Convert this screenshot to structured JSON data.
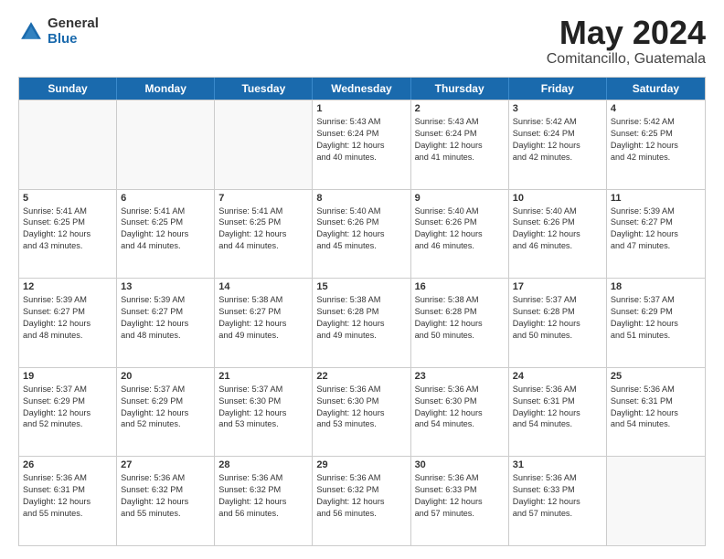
{
  "logo": {
    "general": "General",
    "blue": "Blue"
  },
  "title": {
    "month": "May 2024",
    "location": "Comitancillo, Guatemala"
  },
  "header_days": [
    "Sunday",
    "Monday",
    "Tuesday",
    "Wednesday",
    "Thursday",
    "Friday",
    "Saturday"
  ],
  "weeks": [
    [
      {
        "day": "",
        "text": "",
        "empty": true
      },
      {
        "day": "",
        "text": "",
        "empty": true
      },
      {
        "day": "",
        "text": "",
        "empty": true
      },
      {
        "day": "1",
        "text": "Sunrise: 5:43 AM\nSunset: 6:24 PM\nDaylight: 12 hours\nand 40 minutes.",
        "empty": false
      },
      {
        "day": "2",
        "text": "Sunrise: 5:43 AM\nSunset: 6:24 PM\nDaylight: 12 hours\nand 41 minutes.",
        "empty": false
      },
      {
        "day": "3",
        "text": "Sunrise: 5:42 AM\nSunset: 6:24 PM\nDaylight: 12 hours\nand 42 minutes.",
        "empty": false
      },
      {
        "day": "4",
        "text": "Sunrise: 5:42 AM\nSunset: 6:25 PM\nDaylight: 12 hours\nand 42 minutes.",
        "empty": false
      }
    ],
    [
      {
        "day": "5",
        "text": "Sunrise: 5:41 AM\nSunset: 6:25 PM\nDaylight: 12 hours\nand 43 minutes.",
        "empty": false
      },
      {
        "day": "6",
        "text": "Sunrise: 5:41 AM\nSunset: 6:25 PM\nDaylight: 12 hours\nand 44 minutes.",
        "empty": false
      },
      {
        "day": "7",
        "text": "Sunrise: 5:41 AM\nSunset: 6:25 PM\nDaylight: 12 hours\nand 44 minutes.",
        "empty": false
      },
      {
        "day": "8",
        "text": "Sunrise: 5:40 AM\nSunset: 6:26 PM\nDaylight: 12 hours\nand 45 minutes.",
        "empty": false
      },
      {
        "day": "9",
        "text": "Sunrise: 5:40 AM\nSunset: 6:26 PM\nDaylight: 12 hours\nand 46 minutes.",
        "empty": false
      },
      {
        "day": "10",
        "text": "Sunrise: 5:40 AM\nSunset: 6:26 PM\nDaylight: 12 hours\nand 46 minutes.",
        "empty": false
      },
      {
        "day": "11",
        "text": "Sunrise: 5:39 AM\nSunset: 6:27 PM\nDaylight: 12 hours\nand 47 minutes.",
        "empty": false
      }
    ],
    [
      {
        "day": "12",
        "text": "Sunrise: 5:39 AM\nSunset: 6:27 PM\nDaylight: 12 hours\nand 48 minutes.",
        "empty": false
      },
      {
        "day": "13",
        "text": "Sunrise: 5:39 AM\nSunset: 6:27 PM\nDaylight: 12 hours\nand 48 minutes.",
        "empty": false
      },
      {
        "day": "14",
        "text": "Sunrise: 5:38 AM\nSunset: 6:27 PM\nDaylight: 12 hours\nand 49 minutes.",
        "empty": false
      },
      {
        "day": "15",
        "text": "Sunrise: 5:38 AM\nSunset: 6:28 PM\nDaylight: 12 hours\nand 49 minutes.",
        "empty": false
      },
      {
        "day": "16",
        "text": "Sunrise: 5:38 AM\nSunset: 6:28 PM\nDaylight: 12 hours\nand 50 minutes.",
        "empty": false
      },
      {
        "day": "17",
        "text": "Sunrise: 5:37 AM\nSunset: 6:28 PM\nDaylight: 12 hours\nand 50 minutes.",
        "empty": false
      },
      {
        "day": "18",
        "text": "Sunrise: 5:37 AM\nSunset: 6:29 PM\nDaylight: 12 hours\nand 51 minutes.",
        "empty": false
      }
    ],
    [
      {
        "day": "19",
        "text": "Sunrise: 5:37 AM\nSunset: 6:29 PM\nDaylight: 12 hours\nand 52 minutes.",
        "empty": false
      },
      {
        "day": "20",
        "text": "Sunrise: 5:37 AM\nSunset: 6:29 PM\nDaylight: 12 hours\nand 52 minutes.",
        "empty": false
      },
      {
        "day": "21",
        "text": "Sunrise: 5:37 AM\nSunset: 6:30 PM\nDaylight: 12 hours\nand 53 minutes.",
        "empty": false
      },
      {
        "day": "22",
        "text": "Sunrise: 5:36 AM\nSunset: 6:30 PM\nDaylight: 12 hours\nand 53 minutes.",
        "empty": false
      },
      {
        "day": "23",
        "text": "Sunrise: 5:36 AM\nSunset: 6:30 PM\nDaylight: 12 hours\nand 54 minutes.",
        "empty": false
      },
      {
        "day": "24",
        "text": "Sunrise: 5:36 AM\nSunset: 6:31 PM\nDaylight: 12 hours\nand 54 minutes.",
        "empty": false
      },
      {
        "day": "25",
        "text": "Sunrise: 5:36 AM\nSunset: 6:31 PM\nDaylight: 12 hours\nand 54 minutes.",
        "empty": false
      }
    ],
    [
      {
        "day": "26",
        "text": "Sunrise: 5:36 AM\nSunset: 6:31 PM\nDaylight: 12 hours\nand 55 minutes.",
        "empty": false
      },
      {
        "day": "27",
        "text": "Sunrise: 5:36 AM\nSunset: 6:32 PM\nDaylight: 12 hours\nand 55 minutes.",
        "empty": false
      },
      {
        "day": "28",
        "text": "Sunrise: 5:36 AM\nSunset: 6:32 PM\nDaylight: 12 hours\nand 56 minutes.",
        "empty": false
      },
      {
        "day": "29",
        "text": "Sunrise: 5:36 AM\nSunset: 6:32 PM\nDaylight: 12 hours\nand 56 minutes.",
        "empty": false
      },
      {
        "day": "30",
        "text": "Sunrise: 5:36 AM\nSunset: 6:33 PM\nDaylight: 12 hours\nand 57 minutes.",
        "empty": false
      },
      {
        "day": "31",
        "text": "Sunrise: 5:36 AM\nSunset: 6:33 PM\nDaylight: 12 hours\nand 57 minutes.",
        "empty": false
      },
      {
        "day": "",
        "text": "",
        "empty": true
      }
    ]
  ]
}
